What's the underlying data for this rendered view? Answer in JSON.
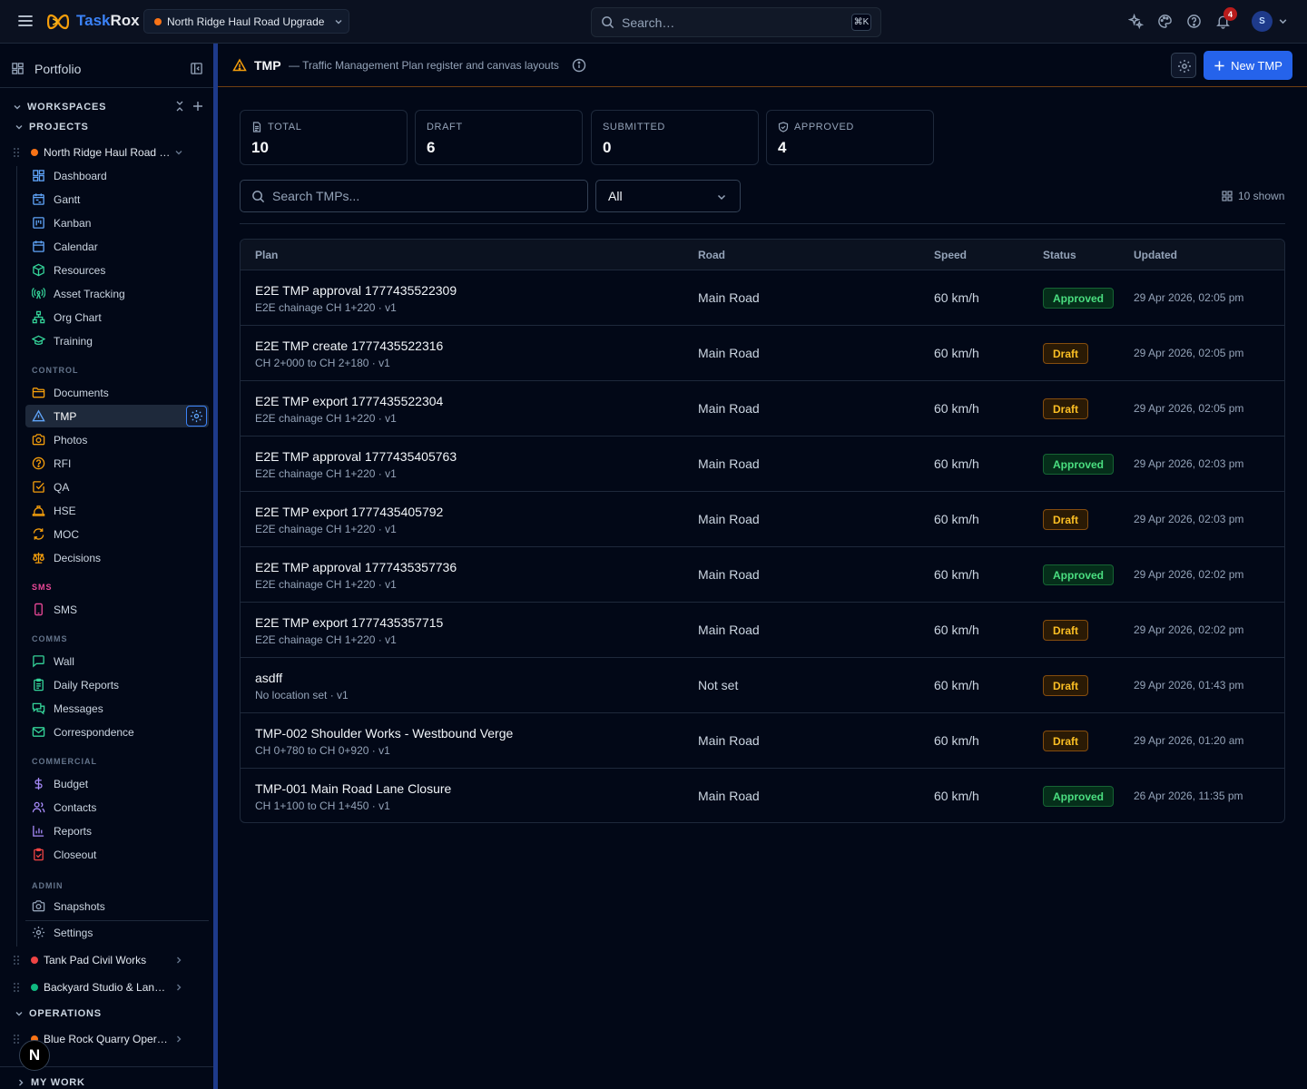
{
  "topbar": {
    "brand_a": "Task",
    "brand_b": "Rox",
    "project": "North Ridge Haul Road Upgrade",
    "search_placeholder": "Search…",
    "shortcut": "⌘K",
    "notifications": "4",
    "avatar": "S"
  },
  "sidebar": {
    "portfolio": "Portfolio",
    "workspaces": "WORKSPACES",
    "projects_label": "PROJECTS",
    "current_project": "North Ridge Haul Road Upgrade",
    "nav_main": [
      "Dashboard",
      "Gantt",
      "Kanban",
      "Calendar",
      "Resources",
      "Asset Tracking",
      "Org Chart",
      "Training"
    ],
    "cat_control": "CONTROL",
    "nav_control": [
      "Documents",
      "TMP",
      "Photos",
      "RFI",
      "QA",
      "HSE",
      "MOC",
      "Decisions"
    ],
    "cat_sms": "SMS",
    "nav_sms": [
      "SMS"
    ],
    "cat_comms": "COMMS",
    "nav_comms": [
      "Wall",
      "Daily Reports",
      "Messages",
      "Correspondence"
    ],
    "cat_commercial": "COMMERCIAL",
    "nav_commercial": [
      "Budget",
      "Contacts",
      "Reports",
      "Closeout"
    ],
    "cat_admin": "ADMIN",
    "nav_admin": [
      "Snapshots"
    ],
    "settings": "Settings",
    "other_projects": [
      "Tank Pad Civil Works",
      "Backyard Studio & Landscaping"
    ],
    "operations": "OPERATIONS",
    "ops_projects": [
      "Blue Rock Quarry Operations"
    ],
    "my_work": "MY WORK",
    "fab": "N"
  },
  "colors": {
    "accent": "#2563eb",
    "project_orange": "#f97316",
    "project_red": "#ef4444",
    "project_green": "#10b981"
  },
  "page": {
    "title": "TMP",
    "subtitle": "— Traffic Management Plan register and canvas layouts",
    "new_button": "New TMP"
  },
  "stats": [
    {
      "label": "TOTAL",
      "value": "10"
    },
    {
      "label": "DRAFT",
      "value": "6"
    },
    {
      "label": "SUBMITTED",
      "value": "0"
    },
    {
      "label": "APPROVED",
      "value": "4"
    }
  ],
  "filters": {
    "search_placeholder": "Search TMPs...",
    "status_value": "All",
    "shown": "10 shown"
  },
  "table": {
    "headers": [
      "Plan",
      "Road",
      "Speed",
      "Status",
      "Updated"
    ],
    "rows": [
      {
        "plan": "E2E TMP approval 1777435522309",
        "meta": "E2E chainage CH 1+220 · v1",
        "road": "Main Road",
        "speed": "60 km/h",
        "status": "Approved",
        "updated": "29 Apr 2026, 02:05 pm"
      },
      {
        "plan": "E2E TMP create 1777435522316",
        "meta": "CH 2+000 to CH 2+180 · v1",
        "road": "Main Road",
        "speed": "60 km/h",
        "status": "Draft",
        "updated": "29 Apr 2026, 02:05 pm"
      },
      {
        "plan": "E2E TMP export 1777435522304",
        "meta": "E2E chainage CH 1+220 · v1",
        "road": "Main Road",
        "speed": "60 km/h",
        "status": "Draft",
        "updated": "29 Apr 2026, 02:05 pm"
      },
      {
        "plan": "E2E TMP approval 1777435405763",
        "meta": "E2E chainage CH 1+220 · v1",
        "road": "Main Road",
        "speed": "60 km/h",
        "status": "Approved",
        "updated": "29 Apr 2026, 02:03 pm"
      },
      {
        "plan": "E2E TMP export 1777435405792",
        "meta": "E2E chainage CH 1+220 · v1",
        "road": "Main Road",
        "speed": "60 km/h",
        "status": "Draft",
        "updated": "29 Apr 2026, 02:03 pm"
      },
      {
        "plan": "E2E TMP approval 1777435357736",
        "meta": "E2E chainage CH 1+220 · v1",
        "road": "Main Road",
        "speed": "60 km/h",
        "status": "Approved",
        "updated": "29 Apr 2026, 02:02 pm"
      },
      {
        "plan": "E2E TMP export 1777435357715",
        "meta": "E2E chainage CH 1+220 · v1",
        "road": "Main Road",
        "speed": "60 km/h",
        "status": "Draft",
        "updated": "29 Apr 2026, 02:02 pm"
      },
      {
        "plan": "asdff",
        "meta": "No location set · v1",
        "road": "Not set",
        "speed": "60 km/h",
        "status": "Draft",
        "updated": "29 Apr 2026, 01:43 pm"
      },
      {
        "plan": "TMP-002 Shoulder Works - Westbound Verge",
        "meta": "CH 0+780 to CH 0+920 · v1",
        "road": "Main Road",
        "speed": "60 km/h",
        "status": "Draft",
        "updated": "29 Apr 2026, 01:20 am"
      },
      {
        "plan": "TMP-001 Main Road Lane Closure",
        "meta": "CH 1+100 to CH 1+450 · v1",
        "road": "Main Road",
        "speed": "60 km/h",
        "status": "Approved",
        "updated": "26 Apr 2026, 11:35 pm"
      }
    ]
  }
}
